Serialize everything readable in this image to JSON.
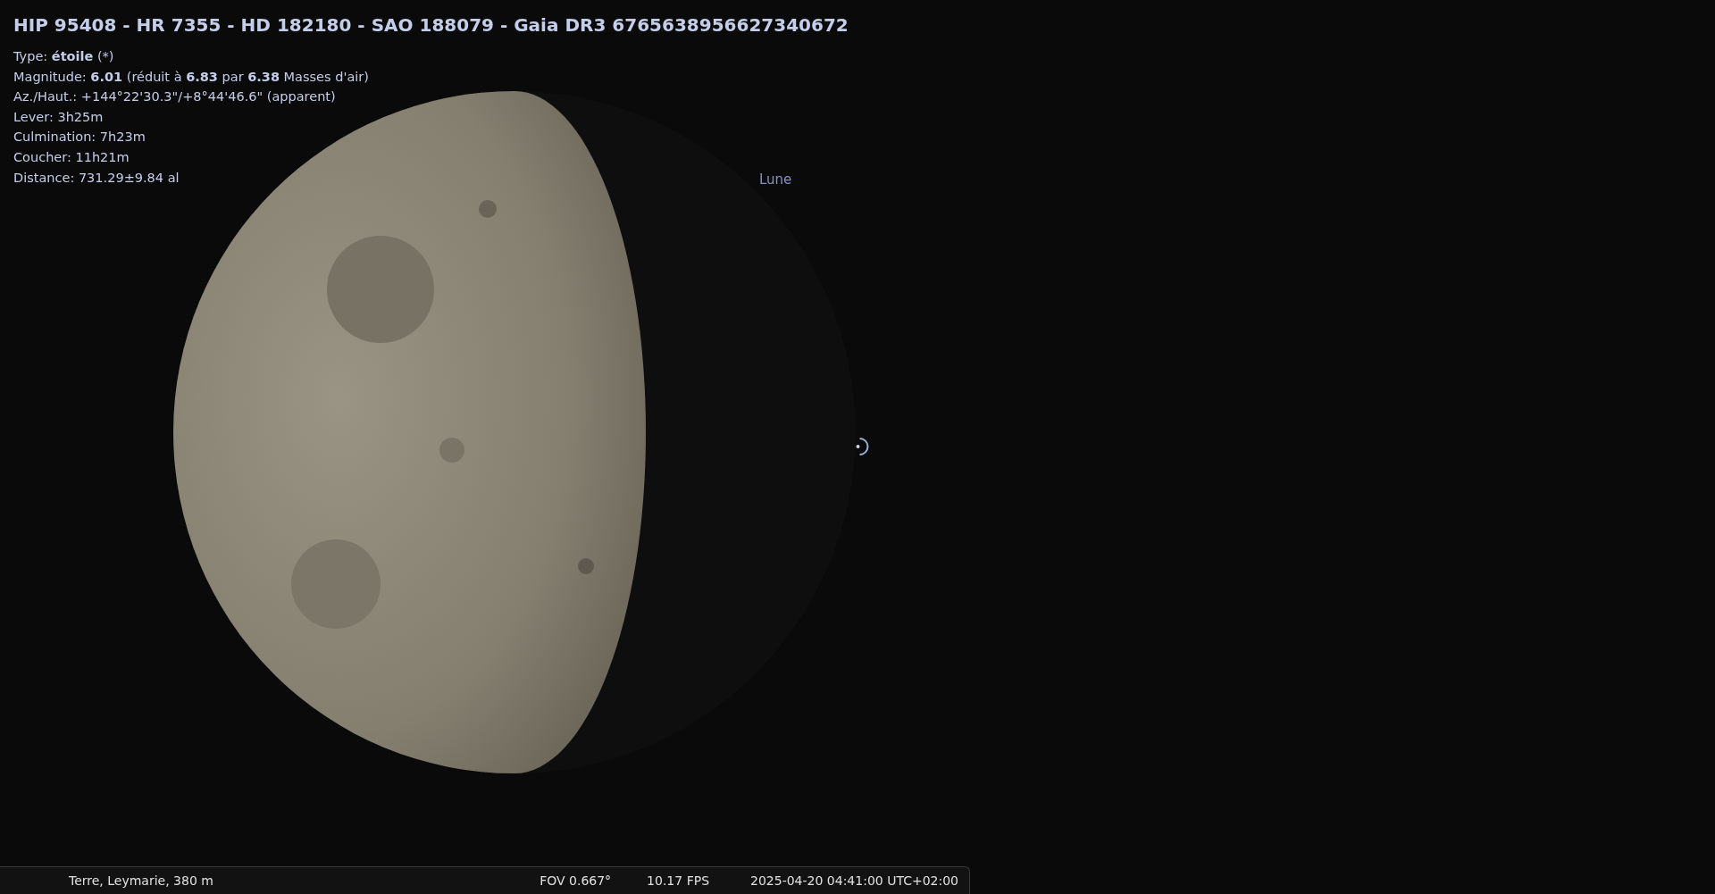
{
  "object_info": {
    "title": "HIP 95408 - HR 7355 - HD 182180 - SAO 188079 - Gaia DR3 6765638956627340672",
    "lines": [
      "Type: **étoile** (*)",
      "Magnitude: **6.01** (réduit à **6.83** par **6.38** Masses d'air)",
      "Az./Haut.: +144°22'30.3\"/+8°44'46.6\" (apparent)",
      "Lever: 3h25m",
      "Culmination: 7h23m",
      "Coucher: 11h21m",
      "Distance: 731.29±9.84 al"
    ]
  },
  "sky": {
    "moon_label": "Lune"
  },
  "status_bar": {
    "location": "Terre, Leymarie, 380 m",
    "fov": "FOV 0.667°",
    "fps": "10.17 FPS",
    "datetime": "2025-04-20 04:41:00 UTC+02:00"
  }
}
